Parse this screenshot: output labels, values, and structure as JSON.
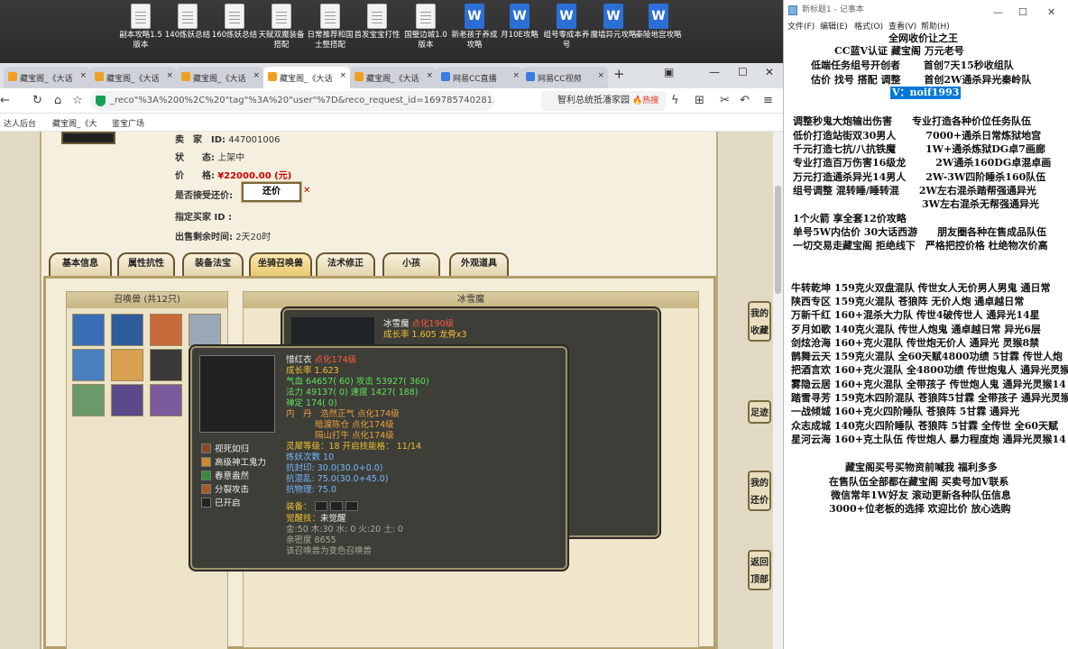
{
  "desktop": {
    "icons": [
      {
        "label": "副本攻略1.5版本",
        "type": "txt"
      },
      {
        "label": "140炼妖总结",
        "type": "txt"
      },
      {
        "label": "160炼妖总结",
        "type": "txt"
      },
      {
        "label": "天赋双魔装备搭配",
        "type": "txt"
      },
      {
        "label": "日常推荐和国士整搭配",
        "type": "txt"
      },
      {
        "label": "首发宝宝打性",
        "type": "txt"
      },
      {
        "label": "国璧边城1.0版本",
        "type": "txt"
      },
      {
        "label": "新老孩子养成攻略",
        "type": "doc"
      },
      {
        "label": "月10E攻略",
        "type": "doc"
      },
      {
        "label": "组号零成本养号",
        "type": "doc"
      },
      {
        "label": "魔墙异元攻略",
        "type": "doc"
      },
      {
        "label": "秦陵地宫攻略",
        "type": "doc"
      }
    ],
    "doc_glyph": "W"
  },
  "browser": {
    "tabs": [
      {
        "label": "藏宝阁_《大话",
        "icon": "gem"
      },
      {
        "label": "藏宝阁_《大话",
        "icon": "gem"
      },
      {
        "label": "藏宝阁_《大话",
        "icon": "gem"
      },
      {
        "label": "藏宝阁_《大话",
        "icon": "gem",
        "active": true
      },
      {
        "label": "藏宝阁_《大话",
        "icon": "gem"
      },
      {
        "label": "网易CC直播",
        "icon": "cc"
      },
      {
        "label": "网易CC视频",
        "icon": "cc"
      }
    ],
    "tab_close": "×",
    "new_tab": "+",
    "window_controls": {
      "pin": "▣",
      "minimize": "—",
      "maximize": "☐",
      "close": "✕"
    },
    "url": "_reco\"%3A%200%2C%20\"tag\"%3A%20\"user\"%7D&reco_request_id=1697857402811Bm6lf",
    "search_text": "智利总统抵潘家园",
    "search_hot": "🔥热搜",
    "bookmarks": [
      {
        "label": "达人后台"
      },
      {
        "label": "藏宝阁_《大"
      },
      {
        "label": "鉴宝广场"
      }
    ],
    "nav_icons": {
      "back": "←",
      "refresh": "↻",
      "home": "⌂",
      "star": "☆",
      "scissors": "✂",
      "undo": "↶",
      "menu": "≡",
      "bolt": "ϟ",
      "grid": "⊞"
    }
  },
  "listing": {
    "seller_label": "卖　家　ID:",
    "seller_id": "447001006",
    "status_label": "状　　态:",
    "status_value": "上架中",
    "price_label": "价　　格:",
    "price_value": "¥22000.00 (元)",
    "haggle_label": "是否接受还价:",
    "haggle_button": "还价",
    "haggle_mark": "✕",
    "buyer_label": "指定买家 ID :",
    "remaining_label": "出售剩余时间:",
    "remaining_value": "2天20时"
  },
  "game_tabs": [
    {
      "label": "基本信息"
    },
    {
      "label": "属性抗性"
    },
    {
      "label": "装备法宝"
    },
    {
      "label": "坐骑召唤兽",
      "active": true
    },
    {
      "label": "法术修正"
    },
    {
      "label": "小孩"
    },
    {
      "label": "外观道具"
    }
  ],
  "pet_list": {
    "title": "召唤兽 (共12只)",
    "colors": [
      "#3a6fb8",
      "#2f5c9c",
      "#c86a3a",
      "#9aa8b8",
      "#4a7fc0",
      "#d8a050",
      "#3a3a3a",
      "#b04040",
      "#6a9a6a",
      "#5a4a8a",
      "#7a5a9a",
      "#4a4a6a"
    ]
  },
  "detail": {
    "title": "冰雪魔"
  },
  "tooltip_back": {
    "name": "冰雪魔",
    "level": "点化190级",
    "growth": "成长率 1.605 龙骨x3"
  },
  "tooltip_front": {
    "name": "惜红衣",
    "level": "点化174级",
    "growth": "成长率 1.623",
    "hp_label": "气血",
    "hp_value": "64657( 60)",
    "atk_label": "攻击",
    "atk_value": "53927( 360)",
    "mp_label": "法力",
    "mp_value": "49137( 0)",
    "spd_label": "速度",
    "spd_value": "1427( 188)",
    "mind_label": "禅定",
    "mind_value": "174( 0)",
    "neidan_label": "内　丹",
    "neidan": [
      "浩然正气 点化174级",
      "暗渡陈仓 点化174级",
      "隔山打牛 点化174级"
    ],
    "soul_label": "灵犀等级：",
    "soul_value": "18 开启技能格：",
    "soul_slots": "11/14",
    "refine": "炼妖次数 10",
    "res_seal": "抗封印: 30.0(30.0+0.0)",
    "res_chaos": "抗混乱: 75.0(30.0+45.0)",
    "res_phys": "抗物理: 75.0",
    "skills": [
      "视死如归",
      "高级神工鬼力",
      "春意盎然",
      "分裂攻击",
      "已开启"
    ],
    "equip_label": "装备：",
    "awaken_label": "觉醒技：",
    "awaken_value": "未觉醒",
    "elements": "金:50 木:30 水: 0 火:20 土: 0",
    "intimacy": "亲密度 8655",
    "note": "该召唤兽为变色召唤兽"
  },
  "side_buttons": [
    {
      "label": "我的收藏"
    },
    {
      "label": "足迹"
    },
    {
      "label": "我的还价"
    },
    {
      "label": "返回顶部"
    }
  ],
  "notepad": {
    "title": "新标题1 - 记事本",
    "menus": [
      "文件(F)",
      "编辑(E)",
      "格式(O)",
      "查看(V)",
      "帮助(H)"
    ],
    "window_controls": {
      "minimize": "—",
      "maximize": "☐",
      "close": "✕"
    },
    "lines": [
      "全网收价让之王",
      "CC蓝V认证 藏宝阁 万元老号",
      "低端任务组号开创者 　　首创7天15秒收组队",
      "估价 找号 搭配 调整 　　首创2W通杀异光秦岭队",
      "V：noif1993",
      "调整秒鬼大炮输出伤害　　专业打造各种价位任务队伍",
      "低价打造站街双30男人　　　7000+通杀日常炼狱地宫",
      "千元打造七抗/八抗铁魔　　　1W+通杀炼狱DG卓7画廊",
      "专业打造百万伤害16级龙　　　2W通杀160DG卓混卓画",
      "万元打造通杀异光14男人　　2W-3W四阶睡杀160队伍",
      "组号调整 混转睡/睡转混　　2W左右混杀踏帮强通异光",
      "　　　　　　　　　　　　　3W左右混杀无帮强通异光",
      "1个火箭 享全套12价攻略",
      "单号5W内估价 30大话西游　　朋友圈各种在售成品队伍",
      "一切交易走藏宝阁 拒绝线下　严格把控价格 杜绝物次价高",
      "牛转乾坤 159克火双盘混队 传世女人无价男人男鬼 通日常",
      "陕西专区 159克火混队 苍狼阵 无价人炮 通卓越日常",
      "万新千红 160+混杀大力队 传世4破传世人 通异光14星",
      "歹月如歌 140克火混队 传世人炮鬼 通卓越日常 异光6层",
      "剑炫沧海 160+克火混队 传世炮无价人 通异光 灵猴8禁",
      "鹊舞云天 159克火混队 全60天赋4800功绩 5甘霖 传世人炮",
      "把酒言欢 160+克火混队 全4800功绩 传世炮鬼人 通异光灵猴",
      "雾隐云居 160+克火混队 全带孩子 传世炮人鬼 通异光灵猴14",
      "踏雪寻芳 159克木四阶混队 苍狼阵5甘霖 全带孩子 通异光灵猴",
      "一战倾城 160+克火四阶睡队 苍狼阵 5甘霖 通异光",
      "众志成城 140克火四阶睡队 苍狼阵 5甘霖 全传世 全60天赋",
      "星河云海 160+克土队伍 传世炮人 暴力程度炮 通异光灵猴14",
      "藏宝阁买号买物资前喊我 福利多多",
      "在售队伍全部都在藏宝阁 买卖号加V联系",
      "微信常年1W好友 滚动更新各种队伍信息",
      "3000+位老板的选择 欢迎比价 放心选购"
    ]
  }
}
